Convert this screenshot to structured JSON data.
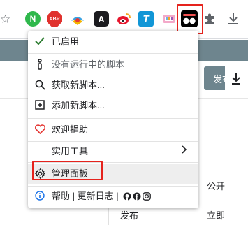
{
  "toolbar": {
    "extensions": [
      {
        "name": "n-extension-icon",
        "text": "N"
      },
      {
        "name": "abp-icon",
        "text": "ABP"
      },
      {
        "name": "map-extension-icon"
      },
      {
        "name": "a-extension-icon",
        "text": "A"
      },
      {
        "name": "weibo-icon"
      },
      {
        "name": "t-extension-icon",
        "text": "T"
      },
      {
        "name": "image-extension-icon"
      },
      {
        "name": "tampermonkey-icon"
      },
      {
        "name": "puzzle-icon"
      },
      {
        "name": "download-icon"
      }
    ],
    "n_text": "N",
    "abp_text": "ABP",
    "a_text": "A",
    "t_text": "T"
  },
  "colors": {
    "highlight_red": "#e5231d",
    "page_header": "#6e858e",
    "enabled_check": "#2e7d32",
    "donate_heart": "#e53935",
    "info_blue": "#1a73e8"
  },
  "page": {
    "publish_button": "发布",
    "row1_label": "",
    "row1_value": "公开",
    "row2_label": "发布",
    "row2_value": "立即"
  },
  "menu": {
    "enabled": "已启用",
    "no_running": "没有运行中的脚本",
    "get_new": "获取新脚本...",
    "add_new": "添加新脚本...",
    "donate": "欢迎捐助",
    "utilities": "实用工具",
    "dashboard": "管理面板",
    "footer": "帮助 | 更新日志 |"
  }
}
